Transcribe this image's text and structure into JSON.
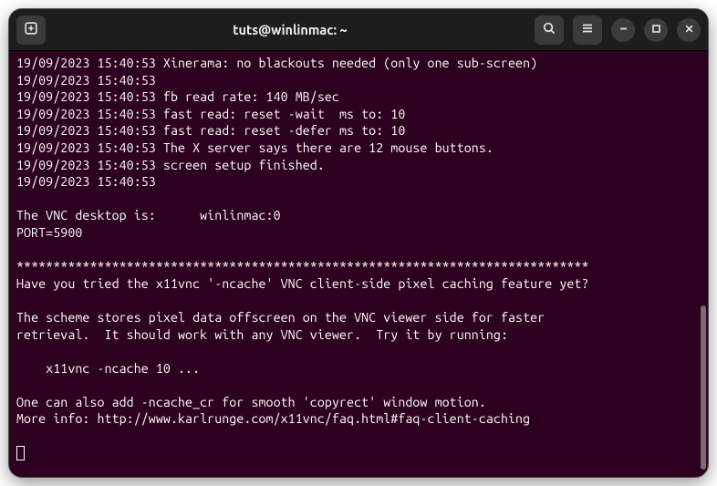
{
  "window": {
    "title": "tuts@winlinmac: ~"
  },
  "icons": {
    "new_tab": "new-tab-icon",
    "search": "search-icon",
    "menu": "hamburger-icon",
    "minimize": "minimize-icon",
    "maximize": "maximize-icon",
    "close": "close-icon"
  },
  "terminal": {
    "lines": [
      "19/09/2023 15:40:53 Xinerama: no blackouts needed (only one sub-screen)",
      "19/09/2023 15:40:53 ",
      "19/09/2023 15:40:53 fb read rate: 140 MB/sec",
      "19/09/2023 15:40:53 fast read: reset -wait  ms to: 10",
      "19/09/2023 15:40:53 fast read: reset -defer ms to: 10",
      "19/09/2023 15:40:53 The X server says there are 12 mouse buttons.",
      "19/09/2023 15:40:53 screen setup finished.",
      "19/09/2023 15:40:53 ",
      "",
      "The VNC desktop is:      winlinmac:0",
      "PORT=5900",
      "",
      "******************************************************************************",
      "Have you tried the x11vnc '-ncache' VNC client-side pixel caching feature yet?",
      "",
      "The scheme stores pixel data offscreen on the VNC viewer side for faster",
      "retrieval.  It should work with any VNC viewer.  Try it by running:",
      "",
      "    x11vnc -ncache 10 ...",
      "",
      "One can also add -ncache_cr for smooth 'copyrect' window motion.",
      "More info: http://www.karlrunge.com/x11vnc/faq.html#faq-client-caching",
      ""
    ]
  }
}
